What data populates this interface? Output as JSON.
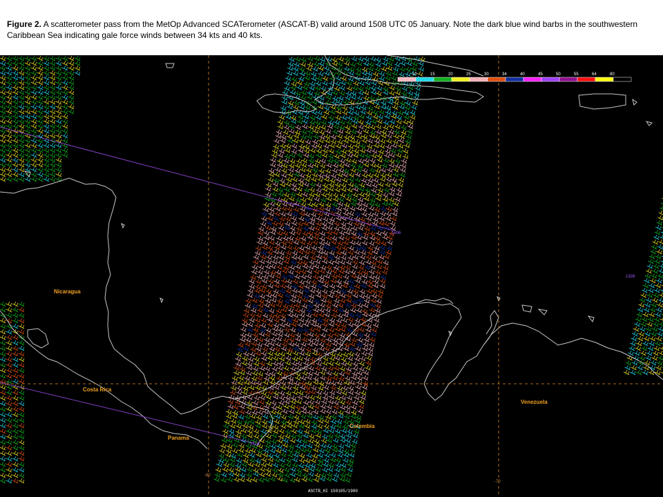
{
  "caption": {
    "lead": "Figure 2.",
    "text": " A scatterometer pass from the MetOp Advanced SCATerometer (ASCAT-B) valid around 1508 UTC 05 January. Note the dark blue wind barbs in the southwestern Caribbean Sea indicating gale force winds between 34 kts and 40 kts."
  },
  "legend": {
    "items": [
      {
        "label": "10",
        "color": "#f4b8c0"
      },
      {
        "label": "15",
        "color": "#20d8e8"
      },
      {
        "label": "20",
        "color": "#10b020"
      },
      {
        "label": "25",
        "color": "#f0f020"
      },
      {
        "label": "30",
        "color": "#f4b0b8"
      },
      {
        "label": "34",
        "color": "#e05010"
      },
      {
        "label": "40",
        "color": "#1030a0"
      },
      {
        "label": "45",
        "color": "#ff20ff"
      },
      {
        "label": "50",
        "color": "#a040ff"
      },
      {
        "label": "55",
        "color": "#901090"
      },
      {
        "label": "64",
        "color": "#ff1010"
      },
      {
        "label": "80",
        "color": "#ffff10"
      },
      {
        "label": "",
        "color": "#000000"
      }
    ]
  },
  "countries": {
    "nicaragua": "Nicaragua",
    "costa_rica": "Costa Rica",
    "panama": "Panama",
    "colombia": "Colombia",
    "venezuela": "Venezuela"
  },
  "orbit_labels": {
    "center": "1506",
    "right": "1328",
    "bottom": "1510"
  },
  "grid_labels": {
    "lat10": "10",
    "lon80": "-80",
    "lon70": "-70"
  },
  "footer": "ASCTB_HI 150105/1900",
  "colors": {
    "map_background": "#000000",
    "coastline": "#c8c8c8",
    "grid": "#b07020",
    "orbit_line": "#8040c0"
  }
}
